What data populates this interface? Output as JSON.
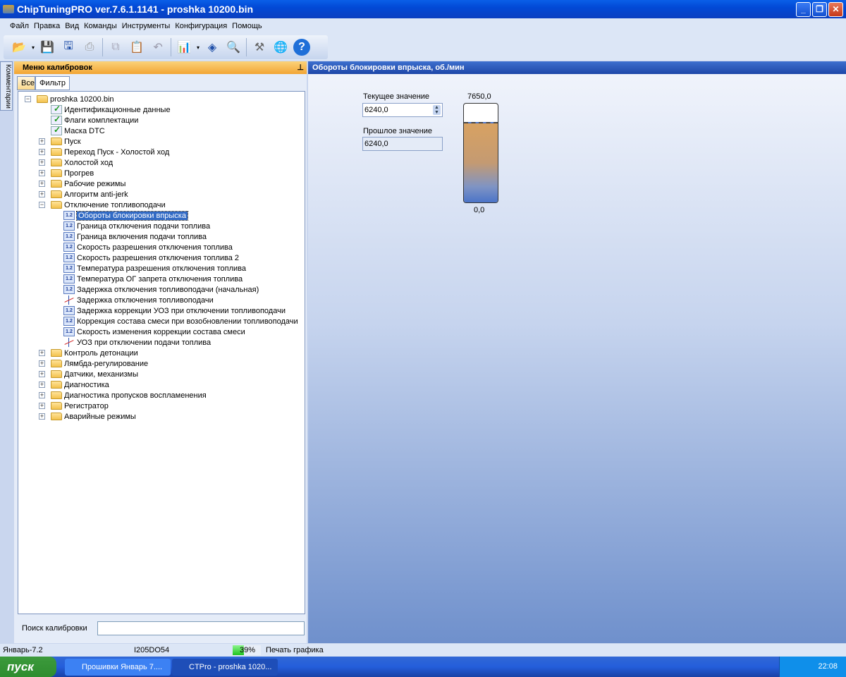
{
  "window": {
    "title": "ChipTuningPRO ver.7.6.1.1141 - proshka 10200.bin"
  },
  "menu": [
    "Файл",
    "Правка",
    "Вид",
    "Команды",
    "Инструменты",
    "Конфигурация",
    "Помощь"
  ],
  "toolbar": [
    "open-icon",
    "save-icon",
    "save-as-icon",
    "print-icon",
    "copy-icon",
    "paste-icon",
    "undo-icon",
    "chart-icon",
    "info-icon",
    "find-icon",
    "tools-icon",
    "web-icon",
    "help-icon"
  ],
  "side_tab": "Комментарии",
  "panel": {
    "title": "Меню калибровок",
    "tabs": [
      "Все",
      "Фильтр"
    ],
    "search_label": "Поиск калибровки",
    "search_value": ""
  },
  "tree": [
    {
      "label": "proshka 10200.bin",
      "level": 0,
      "type": "folder",
      "exp": "−"
    },
    {
      "label": "Идентификационные данные",
      "level": 1,
      "type": "check"
    },
    {
      "label": "Флаги комплектации",
      "level": 1,
      "type": "check"
    },
    {
      "label": "Маска DTC",
      "level": 1,
      "type": "check"
    },
    {
      "label": "Пуск",
      "level": 1,
      "type": "folder",
      "exp": "+"
    },
    {
      "label": "Переход Пуск - Холостой ход",
      "level": 1,
      "type": "folder",
      "exp": "+"
    },
    {
      "label": "Холостой ход",
      "level": 1,
      "type": "folder",
      "exp": "+"
    },
    {
      "label": "Прогрев",
      "level": 1,
      "type": "folder",
      "exp": "+"
    },
    {
      "label": "Рабочие режимы",
      "level": 1,
      "type": "folder",
      "exp": "+"
    },
    {
      "label": "Алгоритм anti-jerk",
      "level": 1,
      "type": "folder",
      "exp": "+"
    },
    {
      "label": "Отключение топливоподачи",
      "level": 1,
      "type": "folder",
      "exp": "−"
    },
    {
      "label": "Обороты блокировки впрыска",
      "level": 2,
      "type": "table",
      "selected": true
    },
    {
      "label": "Граница отключения подачи топлива",
      "level": 2,
      "type": "table"
    },
    {
      "label": "Граница включения подачи топлива",
      "level": 2,
      "type": "table"
    },
    {
      "label": "Скорость разрешения отключения топлива",
      "level": 2,
      "type": "table"
    },
    {
      "label": "Скорость разрешения отключения топлива 2",
      "level": 2,
      "type": "table"
    },
    {
      "label": "Температура разрешения отключения топлива",
      "level": 2,
      "type": "table"
    },
    {
      "label": "Температура ОГ запрета отключения топлива",
      "level": 2,
      "type": "table"
    },
    {
      "label": "Задержка отключения топливоподачи (начальная)",
      "level": 2,
      "type": "table"
    },
    {
      "label": "Задержка отключения топливоподачи",
      "level": 2,
      "type": "graph"
    },
    {
      "label": "Задержка коррекции УОЗ при отключении топливоподачи",
      "level": 2,
      "type": "table"
    },
    {
      "label": "Коррекция состава смеси при возобновлении топливоподачи",
      "level": 2,
      "type": "table"
    },
    {
      "label": "Скорость изменения коррекции состава смеси",
      "level": 2,
      "type": "table"
    },
    {
      "label": "УОЗ при отключении подачи топлива",
      "level": 2,
      "type": "graph"
    },
    {
      "label": "Контроль детонации",
      "level": 1,
      "type": "folder",
      "exp": "+"
    },
    {
      "label": "Лямбда-регулирование",
      "level": 1,
      "type": "folder",
      "exp": "+"
    },
    {
      "label": "Датчики, механизмы",
      "level": 1,
      "type": "folder",
      "exp": "+"
    },
    {
      "label": "Диагностика",
      "level": 1,
      "type": "folder",
      "exp": "+"
    },
    {
      "label": "Диагностика пропусков воспламенения",
      "level": 1,
      "type": "folder",
      "exp": "+"
    },
    {
      "label": "Регистратор",
      "level": 1,
      "type": "folder",
      "exp": "+"
    },
    {
      "label": "Аварийные режимы",
      "level": 1,
      "type": "folder",
      "exp": "+"
    }
  ],
  "editor": {
    "title": "Обороты блокировки впрыска, об./мин",
    "current_label": "Текущее значение",
    "current_value": "6240,0",
    "previous_label": "Прошлое значение",
    "previous_value": "6240,0",
    "gauge_max": "7650,0",
    "gauge_min": "0,0",
    "gauge_fraction": 0.816
  },
  "status": {
    "firmware": "Январь-7.2",
    "ecu": "I205DO54",
    "progress": "39%",
    "progress_fraction": 0.39,
    "message": "Печать графика"
  },
  "taskbar": {
    "start": "пуск",
    "tasks": [
      "Прошивки Январь 7....",
      "CTPro - proshka 1020..."
    ],
    "clock": "22:08"
  }
}
